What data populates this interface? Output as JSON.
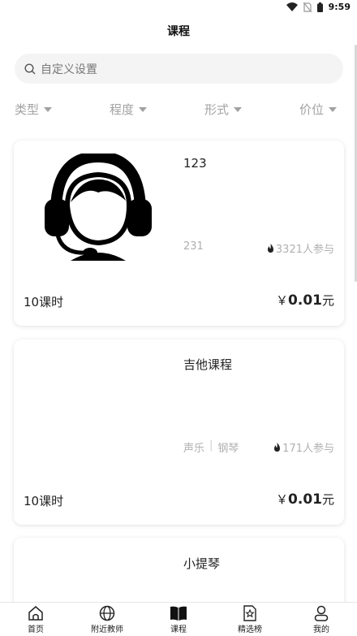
{
  "status_bar": {
    "time": "9:59"
  },
  "header": {
    "title": "课程"
  },
  "search": {
    "placeholder": "自定义设置"
  },
  "filters": [
    {
      "label": "类型"
    },
    {
      "label": "程度"
    },
    {
      "label": "形式"
    },
    {
      "label": "价位"
    }
  ],
  "courses": [
    {
      "title": "123",
      "tags": [
        "231"
      ],
      "participants": "3321人参与",
      "lessons": "10课时",
      "price_prefix": "￥",
      "price": "0.01",
      "price_suffix": "元"
    },
    {
      "title": "吉他课程",
      "tags": [
        "声乐",
        "钢琴"
      ],
      "participants": "171人参与",
      "lessons": "10课时",
      "price_prefix": "￥",
      "price": "0.01",
      "price_suffix": "元"
    },
    {
      "title": "小提琴"
    }
  ],
  "bottom_nav": [
    {
      "label": "首页",
      "icon": "home-icon"
    },
    {
      "label": "附近教师",
      "icon": "globe-icon"
    },
    {
      "label": "课程",
      "icon": "book-icon",
      "active": true
    },
    {
      "label": "精选榜",
      "icon": "star-doc-icon"
    },
    {
      "label": "我的",
      "icon": "user-icon"
    }
  ]
}
